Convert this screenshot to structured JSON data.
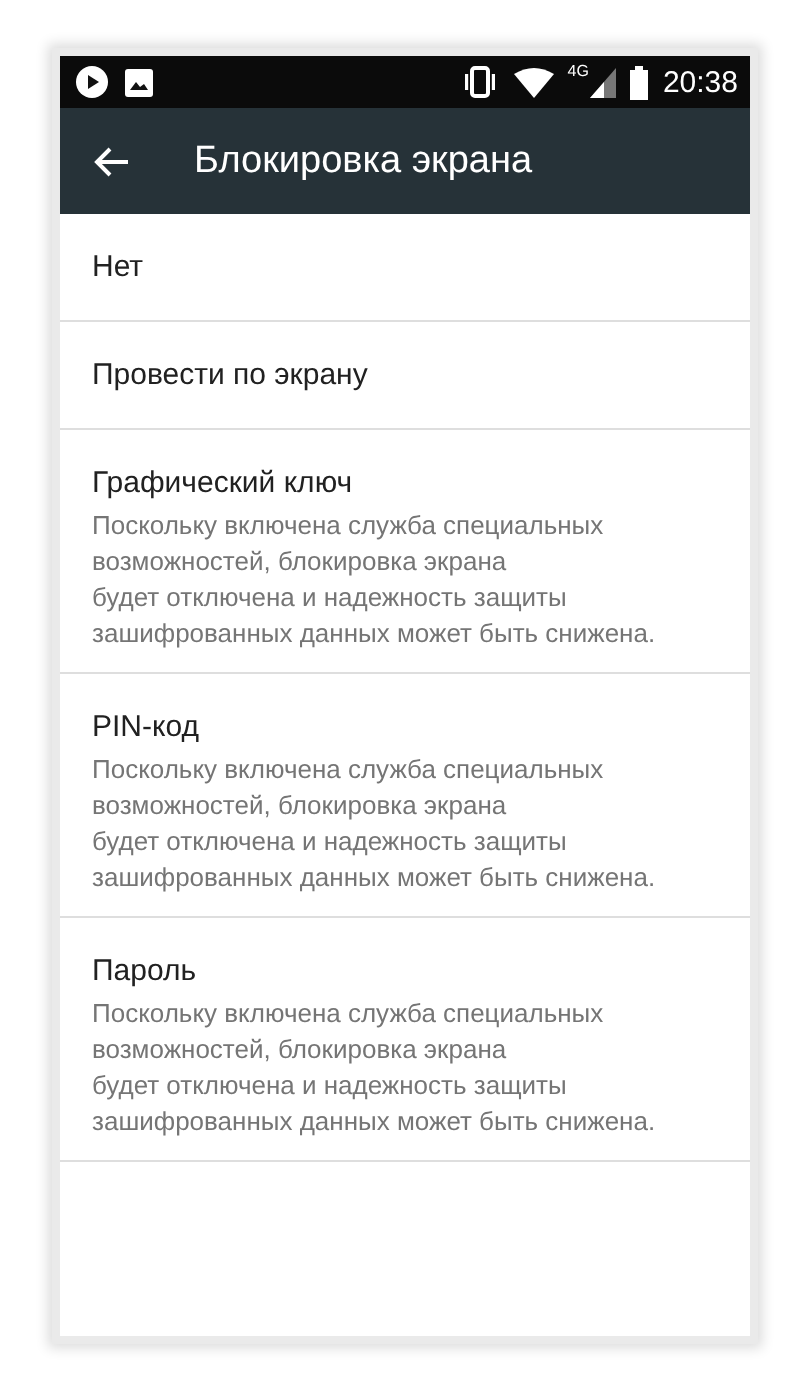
{
  "status_bar": {
    "time": "20:38",
    "network": "4G"
  },
  "toolbar": {
    "title": "Блокировка экрана"
  },
  "options": [
    {
      "title": "Нет"
    },
    {
      "title": "Провести по экрану"
    },
    {
      "title": "Графический ключ",
      "summary_lines": [
        "Поскольку включена служба специальных",
        "возможностей, блокировка экрана",
        "будет отключена и надежность защиты",
        "зашифрованных данных может быть снижена."
      ]
    },
    {
      "title": "PIN-код",
      "summary_lines": [
        "Поскольку включена служба специальных",
        "возможностей, блокировка экрана",
        "будет отключена и надежность защиты",
        "зашифрованных данных может быть снижена."
      ]
    },
    {
      "title": "Пароль",
      "summary_lines": [
        "Поскольку включена служба специальных",
        "возможностей, блокировка экрана",
        "будет отключена и надежность защиты",
        "зашифрованных данных может быть снижена."
      ]
    }
  ]
}
